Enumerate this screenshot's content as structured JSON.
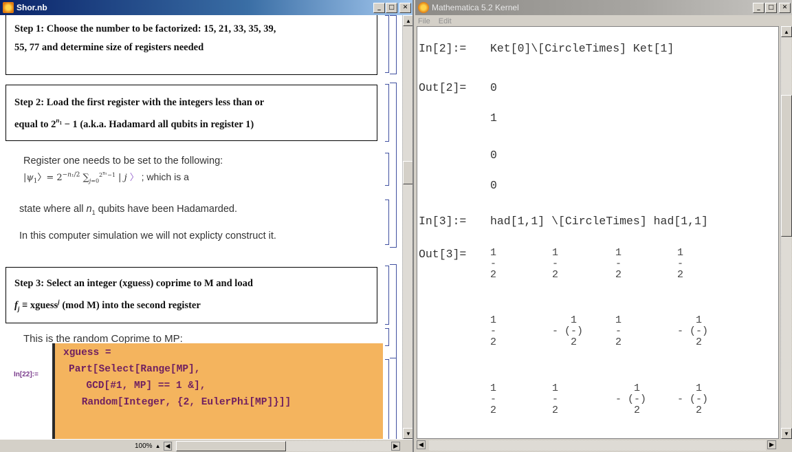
{
  "notebook": {
    "title": "Shor.nb",
    "zoom": "100%",
    "step1": {
      "line1": "Step 1: Choose the number to be factorized: 15, 21, 33, 35, 39,",
      "line2": "55, 77 and determine size of registers needed"
    },
    "step2": {
      "line1": "Step 2: Load the first register with the integers less than or",
      "line2_prefix": "equal to 2",
      "line2_sup": "n",
      "line2_sub": "1",
      "line2_suffix": " − 1 (a.k.a. Hadamard all qubits in register 1)"
    },
    "reg_text": {
      "line1": "Register one needs to be set to the following:",
      "line2": "; which is a",
      "line3_prefix": "state where all ",
      "line3_var": "n",
      "line3_sub": "1",
      "line3_suffix": " qubits have been Hadamarded.",
      "line4": "In this computer simulation we will not explicty construct it."
    },
    "step3": {
      "line1": "Step 3: Select an integer (xguess) coprime to M and load",
      "line2": " ≡ xguess",
      "line2_sup": "j",
      "line2_suffix": " (mod M) into the second register"
    },
    "coprime_text": "This is the random Coprime to MP:",
    "input_label": "In[22]:=",
    "code_lines": [
      "xguess =",
      "Part[Select[Range[MP],",
      "  GCD[#1, MP] == 1 &],",
      " Random[Integer, {2, EulerPhi[MP]}]]"
    ]
  },
  "kernel": {
    "title": "Mathematica 5.2 Kernel",
    "menu": [
      "File",
      "Edit"
    ],
    "in2_label": "In[2]:=",
    "in2": "Ket[0]\\[CircleTimes] Ket[1]",
    "out2_label": "Out[2]=",
    "out2_values": [
      "0",
      "1",
      "0",
      "0"
    ],
    "in3_label": "In[3]:=",
    "in3": "had[1,1] \\[CircleTimes] had[1,1]",
    "out3_label": "Out[3]="
  },
  "colors": {
    "notebook_title_bar": "#0a246a",
    "input_cell": "#f4b45e",
    "cell_bracket": "#4050a0"
  }
}
